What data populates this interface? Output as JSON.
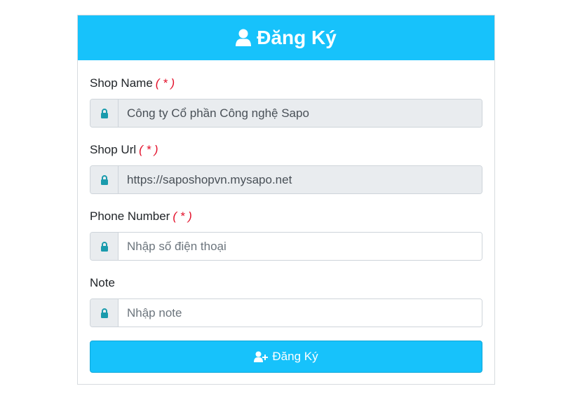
{
  "header": {
    "title": "Đăng Ký",
    "icon": "user-icon",
    "background": "#17c2fb"
  },
  "form": {
    "fields": [
      {
        "label": "Shop Name",
        "required_mark": "( * )",
        "icon": "lock-icon",
        "value": "Công ty Cổ phần Công nghệ Sapo",
        "placeholder": "",
        "readonly": true
      },
      {
        "label": "Shop Url",
        "required_mark": "( * )",
        "icon": "lock-icon",
        "value": "https://saposhopvn.mysapo.net",
        "placeholder": "",
        "readonly": true
      },
      {
        "label": "Phone Number",
        "required_mark": "( * )",
        "icon": "lock-icon",
        "value": "",
        "placeholder": "Nhập số điện thoại",
        "readonly": false
      },
      {
        "label": "Note",
        "icon": "lock-icon",
        "value": "",
        "placeholder": "Nhập note",
        "readonly": false
      }
    ],
    "submit": {
      "label": "Đăng Ký",
      "icon": "user-plus-icon"
    }
  },
  "colors": {
    "accent": "#17c2fb",
    "required": "#e3102a",
    "icon": "#1a9bad"
  }
}
